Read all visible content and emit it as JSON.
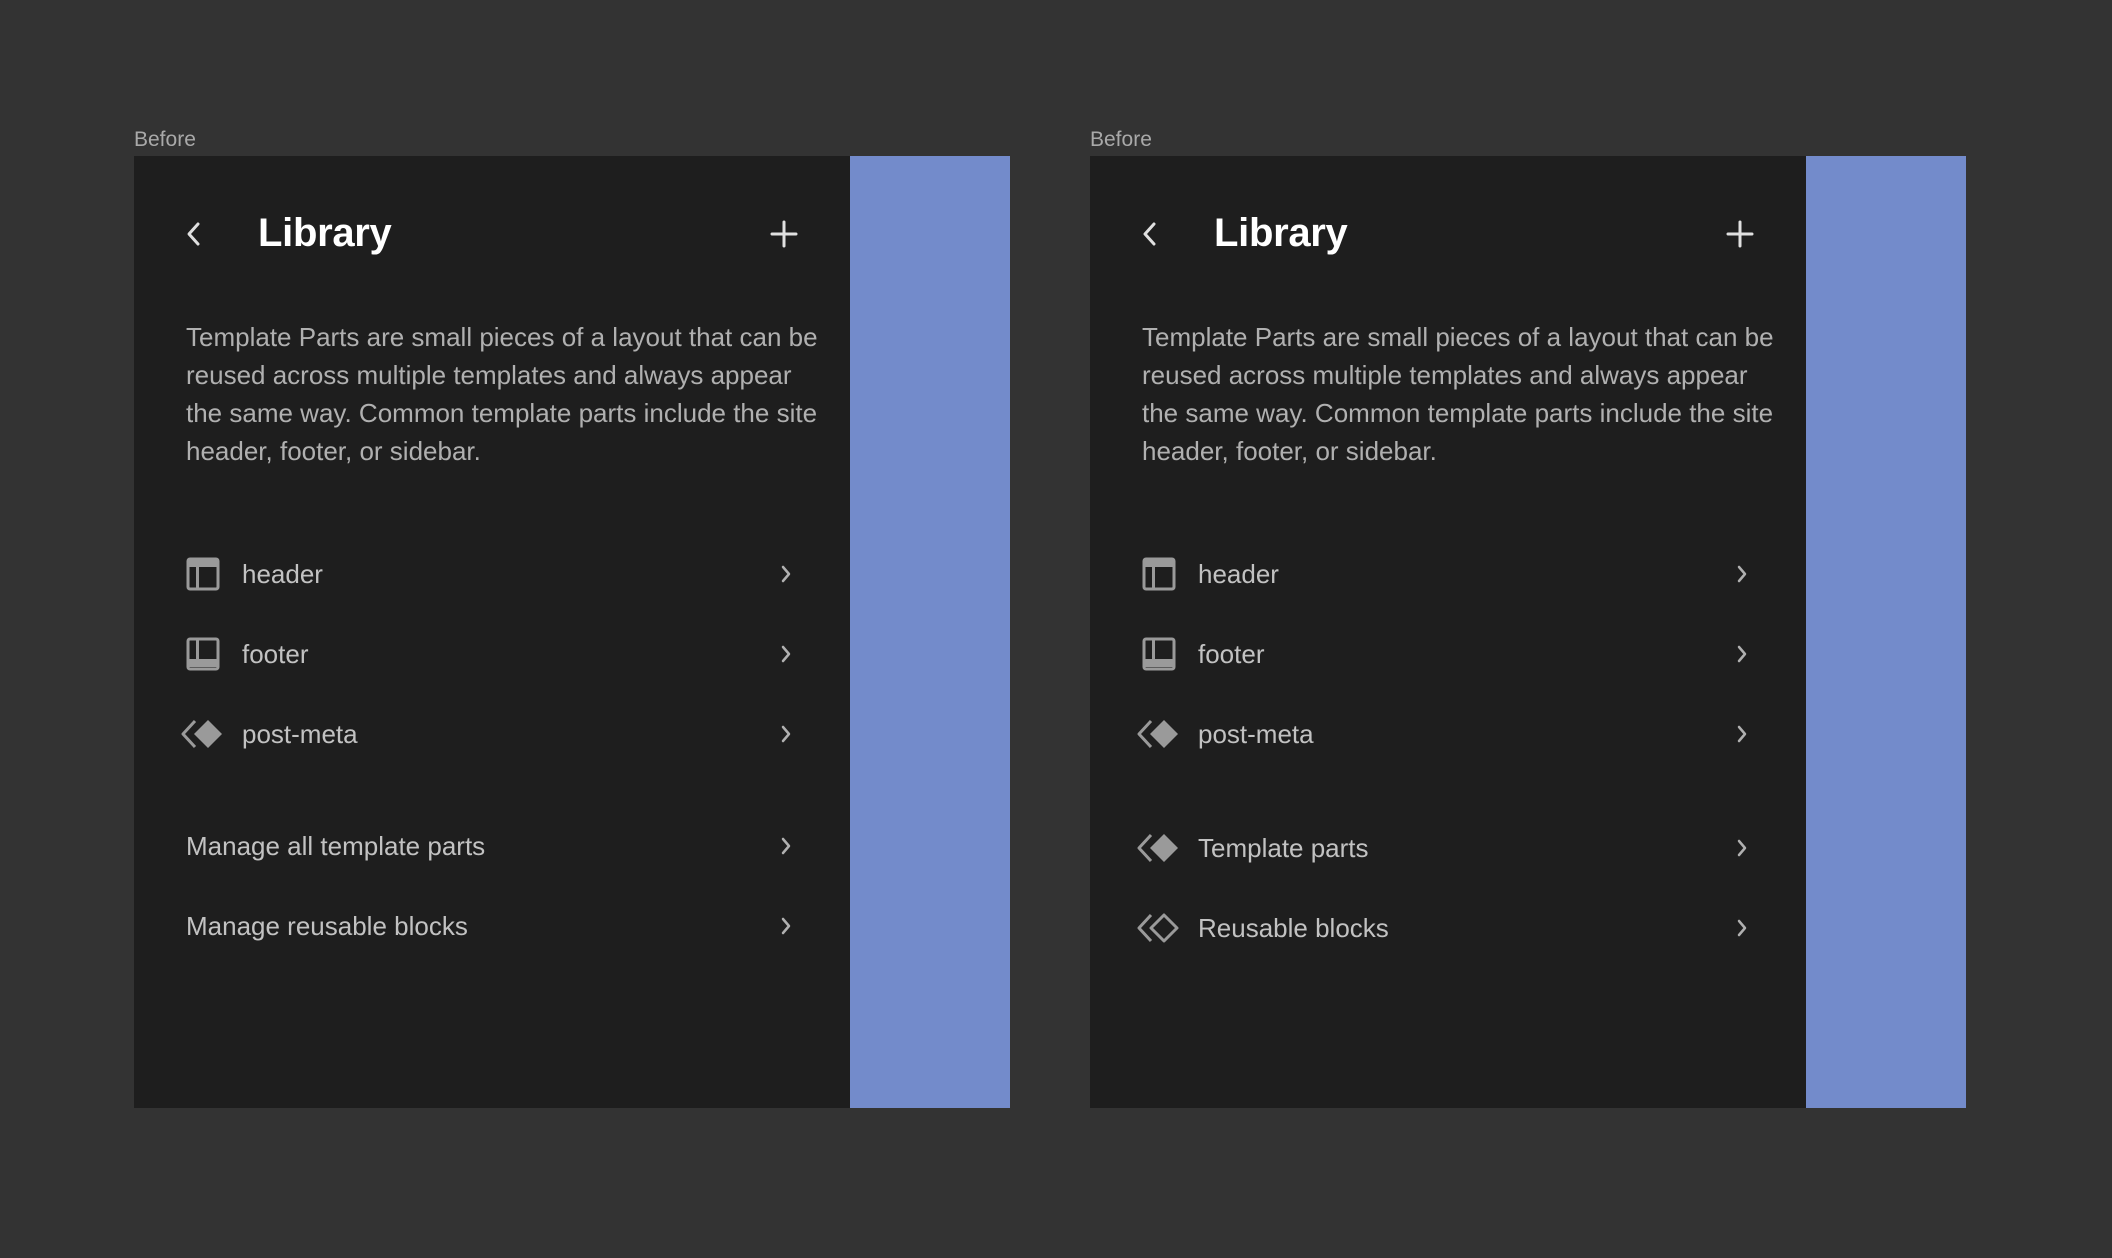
{
  "panels": [
    {
      "caption": "Before",
      "title": "Library",
      "description": "Template Parts are small pieces of a layout that can be reused across multiple templates and always appear the same way. Common template parts include the site header, footer, or sidebar.",
      "items": [
        {
          "label": "header",
          "icon": "header-layout-icon"
        },
        {
          "label": "footer",
          "icon": "footer-layout-icon"
        },
        {
          "label": "post-meta",
          "icon": "symbol-filled-icon"
        }
      ],
      "links": [
        {
          "label": "Manage all template parts"
        },
        {
          "label": "Manage reusable blocks"
        }
      ]
    },
    {
      "caption": "Before",
      "title": "Library",
      "description": "Template Parts are small pieces of a layout that can be reused across multiple templates and always appear the same way. Common template parts include the site header, footer, or sidebar.",
      "items": [
        {
          "label": "header",
          "icon": "header-layout-icon"
        },
        {
          "label": "footer",
          "icon": "footer-layout-icon"
        },
        {
          "label": "post-meta",
          "icon": "symbol-filled-icon"
        }
      ],
      "links": [
        {
          "label": "Template parts",
          "icon": "symbol-filled-icon"
        },
        {
          "label": "Reusable blocks",
          "icon": "symbol-outline-icon"
        }
      ]
    }
  ],
  "colors": {
    "background": "#333333",
    "sidebar": "#1e1e1e",
    "canvas": "#738bcb",
    "text": "#c2c2c2",
    "title": "#ffffff"
  }
}
